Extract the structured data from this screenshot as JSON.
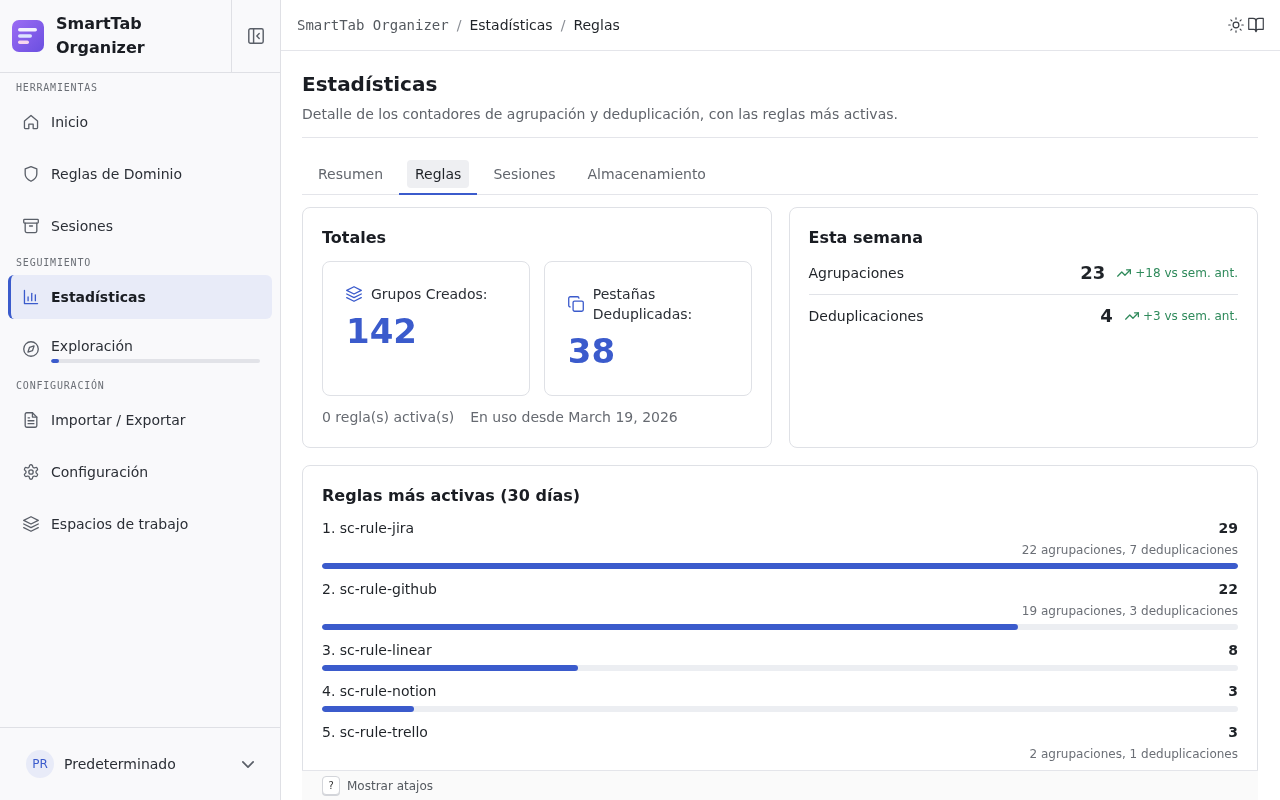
{
  "sidebar": {
    "app_name": "SmartTab Organizer",
    "sections": [
      {
        "label": "HERRAMIENTAS",
        "items": [
          {
            "label": "Inicio",
            "selected": false
          },
          {
            "label": "Reglas de Dominio",
            "selected": false
          },
          {
            "label": "Sesiones",
            "selected": false
          }
        ]
      },
      {
        "label": "SEGUIMIENTO",
        "items": [
          {
            "label": "Estadísticas",
            "selected": true
          },
          {
            "label": "Exploración",
            "selected": false,
            "level": 0.04
          }
        ]
      },
      {
        "label": "CONFIGURACIÓN",
        "items": [
          {
            "label": "Importar / Exportar",
            "selected": false
          },
          {
            "label": "Configuración",
            "selected": false
          },
          {
            "label": "Espacios de trabajo",
            "selected": false
          }
        ]
      }
    ],
    "workspace": {
      "initials": "PR",
      "name": "Predeterminado"
    }
  },
  "breadcrumb": {
    "separator": "/",
    "items": [
      {
        "label": "SmartTab Organizer",
        "kind": "app"
      },
      {
        "label": "Estadísticas",
        "kind": "page"
      },
      {
        "label": "Reglas",
        "kind": "page"
      }
    ]
  },
  "page": {
    "title": "Estadísticas",
    "subtitle": "Detalle de los contadores de agrupación y deduplicación, con las reglas más activas."
  },
  "tabs": [
    {
      "label": "Resumen",
      "selected": false
    },
    {
      "label": "Reglas",
      "selected": true
    },
    {
      "label": "Sesiones",
      "selected": false
    },
    {
      "label": "Almacenamiento",
      "selected": false
    }
  ],
  "totals": {
    "title": "Totales",
    "stats": [
      {
        "label": "Grupos Creados:",
        "value": "142"
      },
      {
        "label": "Pestañas Deduplicadas:",
        "value": "38"
      }
    ],
    "notes": [
      "0 regla(s) activa(s)",
      "En uso desde March 19, 2026"
    ]
  },
  "this_week": {
    "title": "Esta semana",
    "rows": [
      {
        "label": "Agrupaciones",
        "value": "23",
        "trend": "+18 vs sem. ant."
      },
      {
        "label": "Deduplicaciones",
        "value": "4",
        "trend": "+3 vs sem. ant."
      }
    ]
  },
  "top_rules": {
    "title": "Reglas más activas (30 días)",
    "rules": [
      {
        "name": "1. sc-rule-jira",
        "count": "29",
        "detail": "22 agrupaciones, 7 deduplicaciones",
        "level": 1
      },
      {
        "name": "2. sc-rule-github",
        "count": "22",
        "detail": "19 agrupaciones, 3 deduplicaciones",
        "level": 0.76
      },
      {
        "name": "3. sc-rule-linear",
        "count": "8",
        "level": 0.28
      },
      {
        "name": "4. sc-rule-notion",
        "count": "3",
        "level": 0.1
      },
      {
        "name": "5. sc-rule-trello",
        "count": "3",
        "detail": "2 agrupaciones, 1 deduplicaciones"
      }
    ]
  },
  "footer": {
    "key": "?",
    "label": "Mostrar atajos"
  }
}
